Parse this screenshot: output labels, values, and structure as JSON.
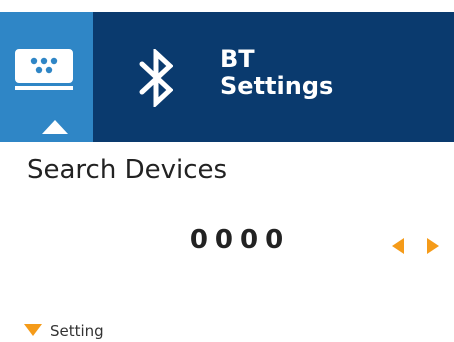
{
  "header": {
    "title_line1": "BT",
    "title_line2": "Settings",
    "mode_icon": "keyboard-icon",
    "bluetooth_icon": "bluetooth-icon"
  },
  "main": {
    "title": "Search Devices",
    "value": "0000"
  },
  "footer": {
    "label": "Setting"
  },
  "colors": {
    "header_bg": "#0a3a6e",
    "mode_tab_bg": "#2f86c6",
    "accent": "#f59b19"
  }
}
